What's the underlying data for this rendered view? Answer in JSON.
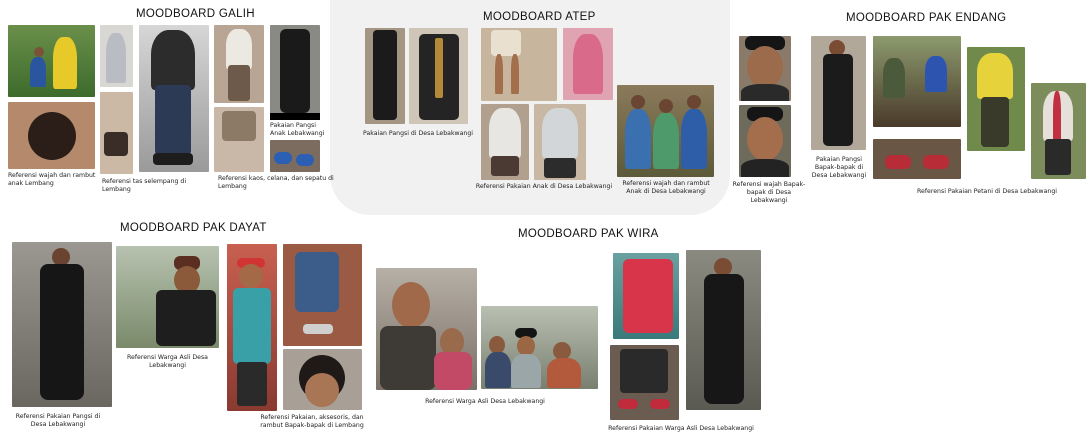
{
  "boards": {
    "galih": {
      "title": "MOODBOARD GALIH",
      "captions": {
        "face": "Referensi wajah dan rambut anak Lembang",
        "bag": "Referensi tas selempang di Lembang",
        "shirt": "Referensi kaos, celana, dan sepatu di Lembang",
        "pangsi": "Pakaian Pangsi Anak Lebakwangi"
      }
    },
    "atep": {
      "title": "MOODBOARD ATEP",
      "captions": {
        "pangsi": "Pakaian Pangsi di Desa Lebakwangi",
        "kids_clothes": "Referensi Pakaian Anak di Desa Lebakwangi",
        "kids_face": "Referensi wajah dan rambut Anak di Desa Lebakwangi"
      }
    },
    "endang": {
      "title": "MOODBOARD PAK ENDANG",
      "captions": {
        "face": "Referensi wajah Bapak-bapak di Desa Lebakwangi",
        "pangsi": "Pakaian Pangsi Bapak-bapak di Desa Lebakwangi",
        "farmer": "Referensi Pakaian Petani di Desa Lebakwangi"
      }
    },
    "dayat": {
      "title": "MOODBOARD PAK DAYAT",
      "captions": {
        "pangsi": "Referensi Pakaian Pangsi di Desa Lebakwangi",
        "resident": "Referensi Warga Asli Desa Lebakwangi",
        "clothes": "Referensi Pakaian, aksesoris, dan rambut Bapak-bapak di Lembang"
      }
    },
    "wira": {
      "title": "MOODBOARD PAK WIRA",
      "captions": {
        "resident": "Referensi Warga Asli Desa Lebakwangi",
        "clothes": "Referensi Pakaian Warga Asli Desa Lebakwangi"
      }
    }
  },
  "colors": {
    "background": "#ffffff",
    "backdrop": "#f1f1f1",
    "title_text": "#111111",
    "caption_text": "#222222"
  }
}
